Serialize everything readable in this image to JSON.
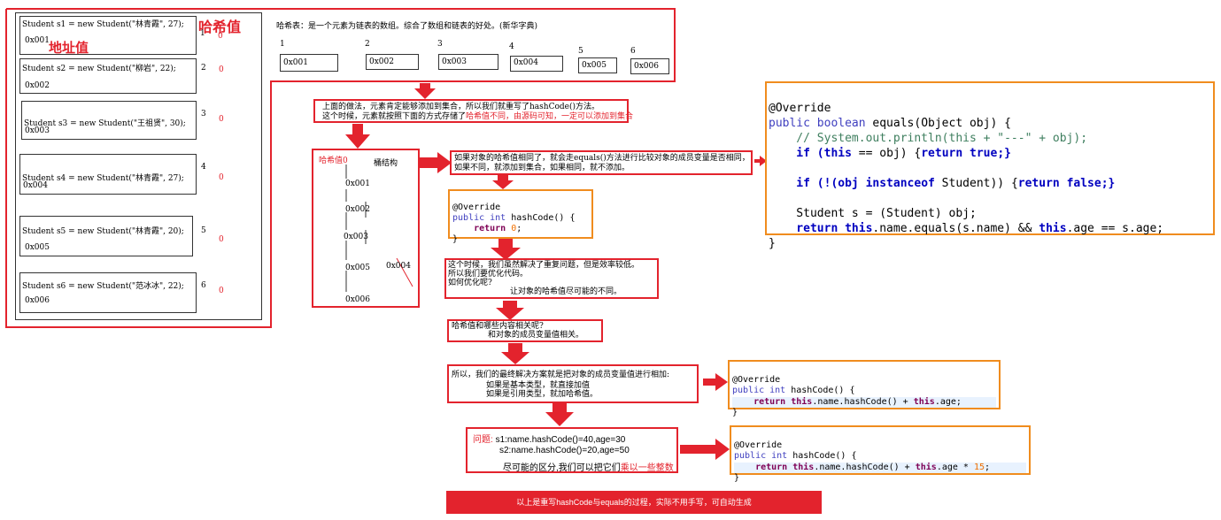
{
  "students": [
    {
      "code": "Student s1 = new Student(\"林青霞\", 27);",
      "addr": "0x001",
      "idx": "1",
      "zero": "0"
    },
    {
      "code": "Student s2 = new Student(\"柳岩\", 22);",
      "addr": "0x002",
      "idx": "2",
      "zero": "0"
    },
    {
      "code": "Student s3 = new Student(\"王祖贤\", 30);",
      "addr": "0x003",
      "idx": "3",
      "zero": "0"
    },
    {
      "code": "Student s4 = new Student(\"林青霞\", 27);",
      "addr": "0x004",
      "idx": "4",
      "zero": "0"
    },
    {
      "code": "Student s5 = new Student(\"林青霞\", 20);",
      "addr": "0x005",
      "idx": "5",
      "zero": "0"
    },
    {
      "code": "Student s6 = new Student(\"范冰冰\", 22);",
      "addr": "0x006",
      "idx": "6",
      "zero": "0"
    }
  ],
  "labels": {
    "hash_value": "哈希值",
    "address_value": "地址值",
    "hash_table_def": "哈希表：是一个元素为链表的数组。综合了数组和链表的好处。(新华字典)"
  },
  "array_cells": [
    {
      "idx": "1",
      "val": "0x001"
    },
    {
      "idx": "2",
      "val": "0x002"
    },
    {
      "idx": "3",
      "val": "0x003"
    },
    {
      "idx": "4",
      "val": "0x004"
    },
    {
      "idx": "5",
      "val": "0x005"
    },
    {
      "idx": "6",
      "val": "0x006"
    }
  ],
  "step1": {
    "line1": "上面的做法，元素肯定能够添加到集合，所以我们就重写了hashCode()方法。",
    "line2a": "这个时候，元素就按照下面的方式存储了",
    "line2b": "哈希值不同，由源码可知，一定可以添加到集合"
  },
  "bucket": {
    "hash_label": "哈希值0",
    "struct_label": "桶结构",
    "items": [
      "0x001",
      "0x002",
      "0x003",
      "0x005",
      "0x006"
    ],
    "side_item": "0x004"
  },
  "step2": "如果对象的哈希值相同了，就会走equals()方法进行比较对象的成员变量是否相同，如果不同，就添加到集合，如果相同，就不添加。",
  "hash0_code": {
    "l1": "@Override",
    "l2a": "public int ",
    "l2b": "hashCode() {",
    "l3a": "    return ",
    "l3b": "0",
    "l3c": ";",
    "l4": "}"
  },
  "equals_code": {
    "l1": "@Override",
    "l2a": "public boolean ",
    "l2b": "equals(Object obj) {",
    "l3": "    // System.out.println(this + \"---\" + obj);",
    "l4a": "    if (",
    "l4b": "this",
    "l4c": " == obj) {",
    "l4d": "return true",
    "l4e": ";}",
    "l5a": "    if (!(obj ",
    "l5b": "instanceof",
    "l5c": " Student)) {",
    "l5d": "return false",
    "l5e": ";}",
    "l6": "    Student s = (Student) obj;",
    "l7a": "    return ",
    "l7b": "this",
    "l7c": ".name.equals(s.name) && ",
    "l7d": "this",
    "l7e": ".age == s.age;",
    "l8": "}"
  },
  "step3": {
    "l1": "这个时候，我们虽然解决了重复问题，但是效率较低。",
    "l2": "所以我们要优化代码。",
    "l3": "如何优化呢?",
    "l4": "让对象的哈希值尽可能的不同。"
  },
  "step4": {
    "l1": "哈希值和哪些内容相关呢?",
    "l2": "和对象的成员变量值相关。"
  },
  "step5": {
    "l1": "所以，我们的最终解决方案就是把对象的成员变量值进行相加:",
    "l2": "如果是基本类型，就直接加值",
    "l3": "如果是引用类型，就加哈希值。"
  },
  "hash_sum_code": {
    "l1": "@Override",
    "l2a": "public int ",
    "l2b": "hashCode() {",
    "l3a": "    return ",
    "l3b": "this",
    "l3c": ".name.hashCode() + ",
    "l3d": "this",
    "l3e": ".age;",
    "l4": "}"
  },
  "step6": {
    "q": "问题:",
    "l1": "s1:name.hashCode()=40,age=30",
    "l2": "s2:name.hashCode()=20,age=50",
    "l3a": "尽可能的区分,我们可以把它们",
    "l3b": "乘以一些整数"
  },
  "hash_mul_code": {
    "l1": "@Override",
    "l2a": "public int ",
    "l2b": "hashCode() {",
    "l3a": "    return ",
    "l3b": "this",
    "l3c": ".name.hashCode() + ",
    "l3d": "this",
    "l3e": ".age * ",
    "l3f": "15",
    "l3g": ";",
    "l4": "}"
  },
  "footer": "以上是重写hashCode与equals的过程，实际不用手写，可自动生成",
  "colors": {
    "red": "#e3232d",
    "orange": "#f08c1e"
  }
}
